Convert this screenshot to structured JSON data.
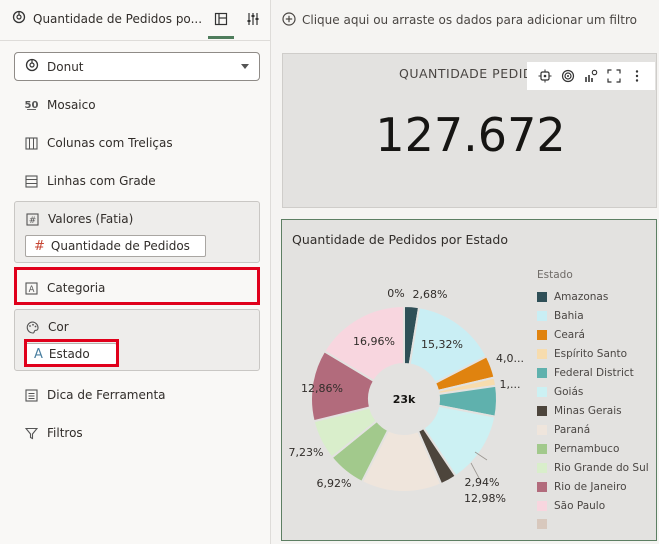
{
  "panel": {
    "tab_title": "Quantidade de Pedidos po...",
    "viz_type": "Donut",
    "rows": [
      {
        "icon": "50",
        "label": "Mosaico"
      },
      {
        "icon": "trellis-columns",
        "label": "Colunas com Treliças"
      },
      {
        "icon": "grid-rows",
        "label": "Linhas com Grade"
      }
    ],
    "values_label": "Valores (Fatia)",
    "values_pill": "Quantidade de Pedidos",
    "category_label": "Categoria",
    "color_label": "Cor",
    "color_pill": "Estado",
    "tooltip_label": "Dica de Ferramenta",
    "filters_label": "Filtros"
  },
  "filterbar": {
    "text": "Clique aqui ou arraste os dados para adicionar um filtro"
  },
  "kpi": {
    "title": "QUANTIDADE PEDID",
    "value": "127.672"
  },
  "chart_data": {
    "type": "pie",
    "title": "Quantidade de Pedidos por Estado",
    "legend_title": "Estado",
    "center_label": "23k",
    "categories": [
      "Amazonas",
      "Bahia",
      "Ceará",
      "Espírito Santo",
      "Federal District",
      "Goiás",
      "Minas Gerais",
      "Paraná",
      "Pernambuco",
      "Rio Grande do Sul",
      "Rio de Janeiro",
      "São Paulo",
      ""
    ],
    "values": [
      2.68,
      15.32,
      4.0,
      1.5,
      5.5,
      12.98,
      2.94,
      14.5,
      6.92,
      7.23,
      12.86,
      16.96,
      0
    ],
    "labels": [
      "2,68%",
      "15,32%",
      "4,0...",
      "1,...",
      "",
      "12,98%",
      "2,94%",
      "",
      "6,92%",
      "7,23%",
      "12,86%",
      "16,96%",
      "0%"
    ],
    "colors": [
      "#2f4f57",
      "#c9eef4",
      "#e0830f",
      "#f7dcae",
      "#5fb1ad",
      "#ccf1f3",
      "#4d453c",
      "#efe5dc",
      "#a2c98c",
      "#d9eecb",
      "#b26b7c",
      "#f8d6df",
      "#d8c8bd"
    ],
    "legend_placement": "right"
  }
}
